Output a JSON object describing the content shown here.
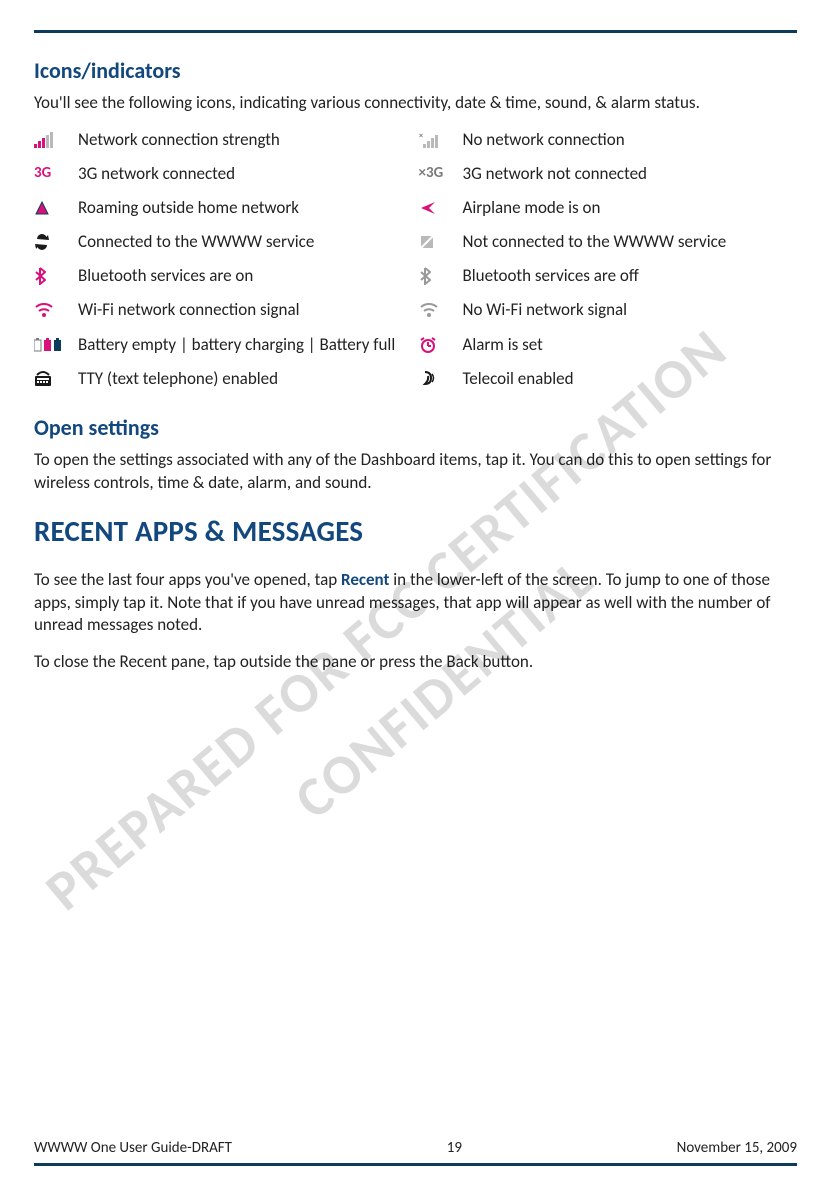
{
  "headings": {
    "icons": "Icons/indicators",
    "open": "Open settings",
    "recent": "RECENT APPS & MESSAGES"
  },
  "paragraphs": {
    "icons_intro": "You'll see the following icons, indicating various connectivity, date & time, sound, & alarm status.",
    "open_body": "To open the settings associated with any of the Dashboard items, tap it. You can do this to open settings for wireless controls, time & date, alarm, and sound.",
    "recent_1a": "To see the last four apps you've opened, tap ",
    "recent_word": "Recent",
    "recent_1b": " in the lower-left of the screen. To jump to one of those apps, simply tap it. Note that if you have unread messages, that app will appear as well with the number of unread messages noted.",
    "recent_2": "To close the Recent pane, tap outside the pane or press the Back button."
  },
  "icons": [
    {
      "left": {
        "name": "signal-bars-icon",
        "label": "Network connection strength"
      },
      "right": {
        "name": "no-signal-icon",
        "label": "No network connection"
      }
    },
    {
      "left": {
        "name": "3g-icon",
        "label": "3G network connected",
        "text": "3G"
      },
      "right": {
        "name": "no-3g-icon",
        "label": "3G network not connected",
        "text": "×3G"
      }
    },
    {
      "left": {
        "name": "roaming-icon",
        "label": "Roaming outside home network"
      },
      "right": {
        "name": "airplane-icon",
        "label": "Airplane mode is on"
      }
    },
    {
      "left": {
        "name": "sync-on-icon",
        "label": "Connected to the WWWW service"
      },
      "right": {
        "name": "sync-off-icon",
        "label": "Not connected to the WWWW service"
      }
    },
    {
      "left": {
        "name": "bluetooth-on-icon",
        "label": "Bluetooth services are on"
      },
      "right": {
        "name": "bluetooth-off-icon",
        "label": "Bluetooth services are off"
      }
    },
    {
      "left": {
        "name": "wifi-on-icon",
        "label": "Wi-Fi network connection signal"
      },
      "right": {
        "name": "wifi-off-icon",
        "label": "No Wi-Fi network signal"
      }
    },
    {
      "left": {
        "name": "battery-icon",
        "label": "Battery empty | battery charging | Battery full"
      },
      "right": {
        "name": "alarm-icon",
        "label": "Alarm is set"
      }
    },
    {
      "left": {
        "name": "tty-icon",
        "label": "TTY (text telephone) enabled"
      },
      "right": {
        "name": "telecoil-icon",
        "label": "Telecoil enabled"
      }
    }
  ],
  "footer": {
    "left": "WWWW One User Guide-DRAFT",
    "center": "19",
    "right": "November 15, 2009"
  },
  "watermark": {
    "line1": "PREPARED FOR FCC CERTIFICATION",
    "line2": "CONFIDENTIAL"
  }
}
